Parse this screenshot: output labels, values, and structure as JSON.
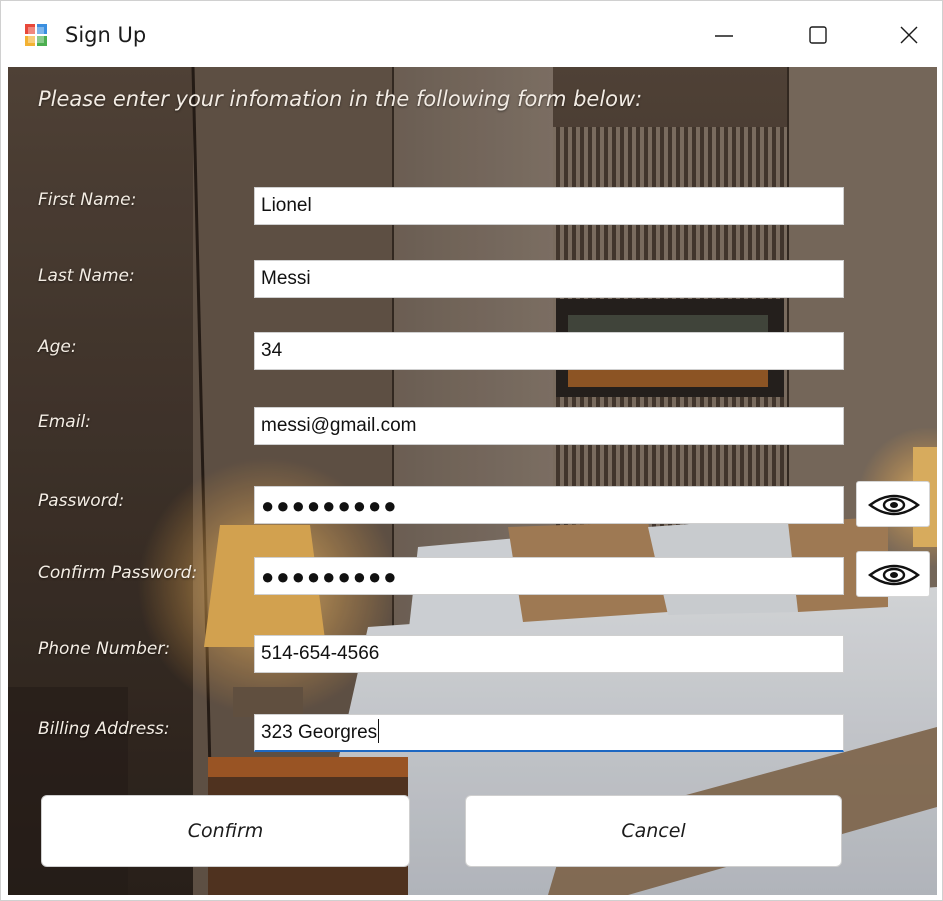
{
  "window": {
    "title": "Sign Up",
    "icon": "windows-form-icon",
    "controls": [
      "minimize-icon",
      "maximize-icon",
      "close-icon"
    ]
  },
  "form": {
    "heading": "Please enter your infomation in the following form below:",
    "fields": {
      "first_name": {
        "label": "First Name:",
        "value": "Lionel"
      },
      "last_name": {
        "label": "Last Name:",
        "value": "Messi"
      },
      "age": {
        "label": "Age:",
        "value": "34"
      },
      "email": {
        "label": "Email:",
        "value": "messi@gmail.com"
      },
      "password": {
        "label": "Password:",
        "value": "●●●●●●●●●",
        "reveal_icon": "eye-icon"
      },
      "confirm_password": {
        "label": "Confirm Password:",
        "value": "●●●●●●●●●",
        "reveal_icon": "eye-icon"
      },
      "phone": {
        "label": "Phone Number:",
        "value": "514-654-4566"
      },
      "billing_address": {
        "label": "Billing Address:",
        "value": "323 Georgres"
      }
    },
    "buttons": {
      "confirm": "Confirm",
      "cancel": "Cancel"
    }
  },
  "colors": {
    "focus_underline": "#1d68c2",
    "label_text": "#f4ede4"
  }
}
